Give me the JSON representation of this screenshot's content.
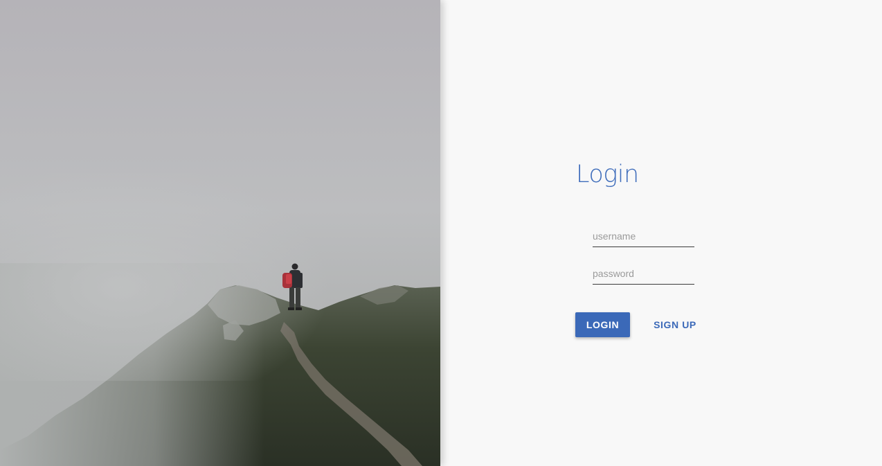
{
  "hero": {
    "image": "misty-mountain-ridge-hiker-photo"
  },
  "login": {
    "title": "Login",
    "username_placeholder": "username",
    "username_value": "",
    "password_placeholder": "password",
    "password_value": "",
    "login_button_label": "LOGIN",
    "signup_button_label": "SIGN UP"
  },
  "colors": {
    "accent": "#3b69b8",
    "title": "#3f6dbb",
    "panel_background": "#f8f8f8"
  }
}
